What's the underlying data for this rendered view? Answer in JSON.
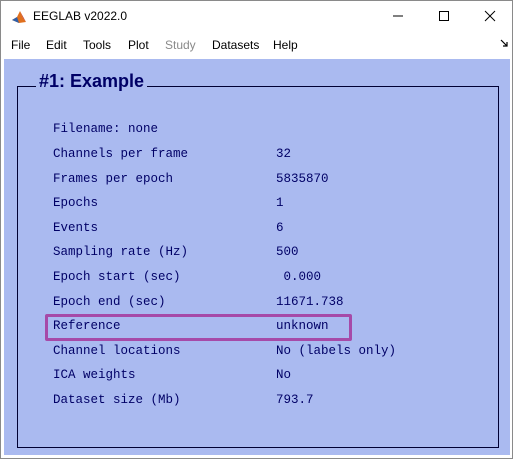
{
  "window": {
    "title": "EEGLAB v2022.0"
  },
  "menu": {
    "items": [
      {
        "label": "File",
        "enabled": true
      },
      {
        "label": "Edit",
        "enabled": true
      },
      {
        "label": "Tools",
        "enabled": true
      },
      {
        "label": "Plot",
        "enabled": true
      },
      {
        "label": "Study",
        "enabled": false
      },
      {
        "label": "Datasets",
        "enabled": true
      },
      {
        "label": "Help",
        "enabled": true
      }
    ]
  },
  "panel": {
    "title": "#1: Example",
    "filename_label": "Filename: none",
    "rows": [
      {
        "label": "Channels per frame",
        "value": "32"
      },
      {
        "label": "Frames per epoch",
        "value": "5835870"
      },
      {
        "label": "Epochs",
        "value": "1"
      },
      {
        "label": "Events",
        "value": "6"
      },
      {
        "label": "Sampling rate (Hz)",
        "value": "500"
      },
      {
        "label": "Epoch start (sec)",
        "value": " 0.000"
      },
      {
        "label": "Epoch end (sec)",
        "value": "11671.738"
      },
      {
        "label": "Reference",
        "value": "unknown"
      },
      {
        "label": "Channel locations",
        "value": "No (labels only)"
      },
      {
        "label": "ICA weights",
        "value": "No"
      },
      {
        "label": "Dataset size (Mb)",
        "value": "793.7"
      }
    ]
  },
  "colors": {
    "background": "#aabaf0",
    "text": "#000066",
    "highlight_border": "#a64aa8"
  }
}
